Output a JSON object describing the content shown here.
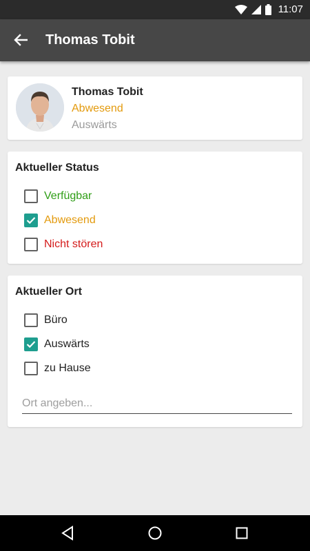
{
  "status_bar": {
    "time": "11:07",
    "icons": [
      "wifi-icon",
      "signal-icon",
      "battery-icon"
    ]
  },
  "app_bar": {
    "title": "Thomas Tobit",
    "back_icon": "arrow-left-icon"
  },
  "profile": {
    "name": "Thomas Tobit",
    "status": "Abwesend",
    "location": "Auswärts"
  },
  "status_section": {
    "title": "Aktueller Status",
    "options": [
      {
        "label": "Verfügbar",
        "checked": false,
        "color": "#2e9d15"
      },
      {
        "label": "Abwesend",
        "checked": true,
        "color": "#e39a0d"
      },
      {
        "label": "Nicht stören",
        "checked": false,
        "color": "#d41a1a"
      }
    ]
  },
  "location_section": {
    "title": "Aktueller Ort",
    "options": [
      {
        "label": "Büro",
        "checked": false
      },
      {
        "label": "Auswärts",
        "checked": true
      },
      {
        "label": "zu Hause",
        "checked": false
      }
    ],
    "input_placeholder": "Ort angeben..."
  },
  "colors": {
    "accent": "#1e9e8f",
    "app_bar": "#474747",
    "status_bar": "#2b2b2b"
  },
  "nav_bar": {
    "icons": [
      "back-triangle-icon",
      "home-circle-icon",
      "recents-square-icon"
    ]
  }
}
